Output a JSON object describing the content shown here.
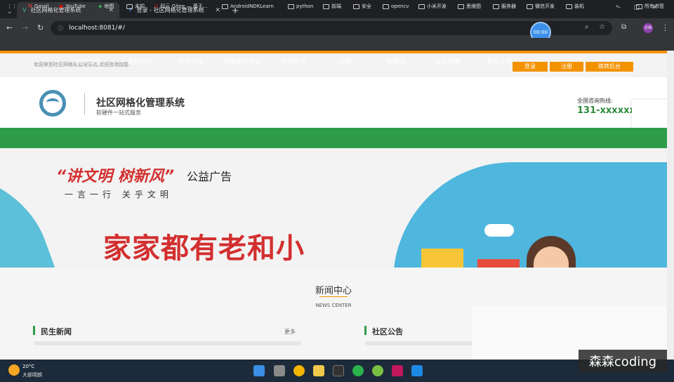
{
  "browser": {
    "tabs": [
      {
        "title": "社区网格化管理系统"
      },
      {
        "title": "登录 - 社区网格化管理系统"
      }
    ],
    "url": "localhost:8081/#/",
    "bookmarks": [
      "Gmail",
      "YouTube",
      "地图",
      "未知",
      "码云 Gitee — 基于...",
      "AndroidNDKLearn",
      "python",
      "前端",
      "安全",
      "opencv",
      "小米开发",
      "思维图",
      "服务器",
      "微信开发",
      "装机"
    ],
    "all_bookmarks": "所有书签",
    "profile": "文档"
  },
  "timer": "00:00",
  "topbar": {
    "welcome": "欢迎来到社区网格化管理系统,欢迎咨询加盟!",
    "login": "登录",
    "register": "注册",
    "admin": "跳转后台"
  },
  "header": {
    "title": "社区网格化管理系统",
    "subtitle": "软硬件一站式服务",
    "hotline_label": "全国咨询热线:",
    "hotline": "131-xxxxxxxx"
  },
  "nav": [
    "网站首页",
    "最新信息",
    "社区信息",
    "网格单元信息",
    "服务信息",
    "问题",
    "网格员",
    "系统概要",
    "意见反馈"
  ],
  "banner": {
    "slogan": "“讲文明 树新风”",
    "slogan_suffix": "公益广告",
    "subline": "一言一行 关乎文明",
    "big": "家家都有老和小"
  },
  "news": {
    "title": "新闻中心",
    "title_en": "NEWS CENTER",
    "col1": "民生新闻",
    "more": "更多",
    "col2": "社区公告"
  },
  "taskbar": {
    "temp": "20°C",
    "weather": "大部晴朗"
  },
  "watermark": "森森coding"
}
